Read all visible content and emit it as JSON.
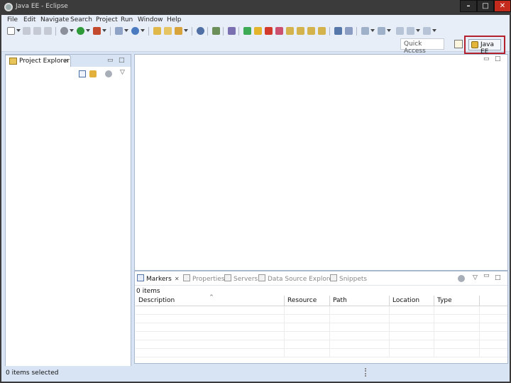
{
  "window": {
    "title": "Java EE - Eclipse"
  },
  "window_controls": {
    "minimize": "–",
    "maximize": "□",
    "close": "✕"
  },
  "menu": [
    "File",
    "Edit",
    "Navigate",
    "Search",
    "Project",
    "Run",
    "Window",
    "Help"
  ],
  "quick_access": {
    "placeholder": "Quick Access"
  },
  "perspective": {
    "active": "Java EE"
  },
  "project_explorer": {
    "tab_label": "Project Explorer"
  },
  "markers_view": {
    "tabs": [
      {
        "label": "Markers",
        "active": true
      },
      {
        "label": "Properties",
        "active": false
      },
      {
        "label": "Servers",
        "active": false
      },
      {
        "label": "Data Source Explorer",
        "active": false
      },
      {
        "label": "Snippets",
        "active": false
      }
    ],
    "count": "0 items",
    "columns": [
      "Description",
      "Resource",
      "Path",
      "Location",
      "Type"
    ]
  },
  "status": {
    "text": "0 items selected"
  },
  "colors": {
    "accent_highlight": "#b3202e",
    "chrome": "#d8e4f3",
    "title_bar": "#3b3b3b"
  }
}
